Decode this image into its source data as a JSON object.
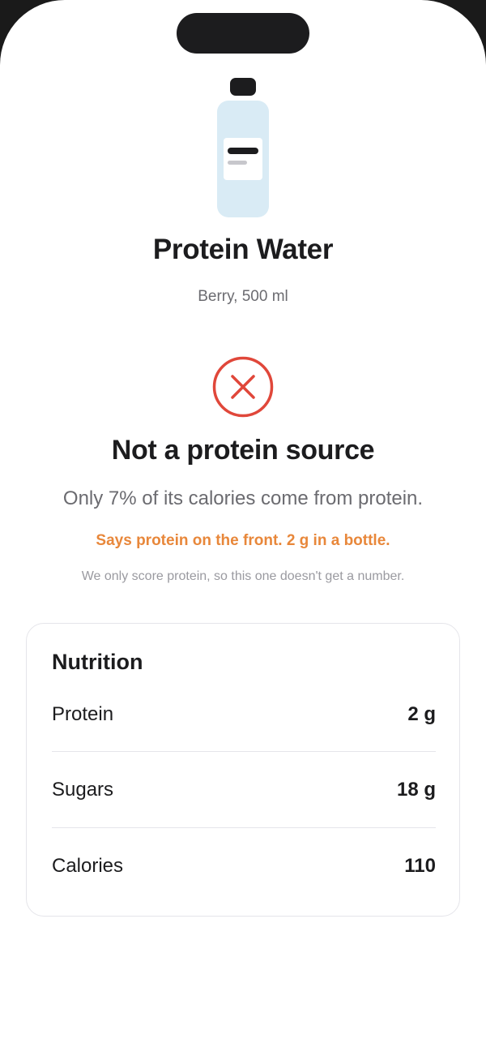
{
  "product": {
    "name": "Protein Water",
    "variant": "Berry, 500 ml",
    "image_icon": "bottle-icon"
  },
  "verdict": {
    "icon": "x-circle-icon",
    "icon_color": "#e0473a",
    "headline": "Not a protein source",
    "explanation": "Only 7% of its calories come from protein.",
    "warning": "Says protein on the front. 2 g in a bottle.",
    "warning_color": "#e8873a",
    "note": "We only score protein, so this one doesn't get a number."
  },
  "nutrition": {
    "title": "Nutrition",
    "rows": [
      {
        "label": "Protein",
        "value": "2 g"
      },
      {
        "label": "Sugars",
        "value": "18 g"
      },
      {
        "label": "Calories",
        "value": "110"
      }
    ]
  }
}
